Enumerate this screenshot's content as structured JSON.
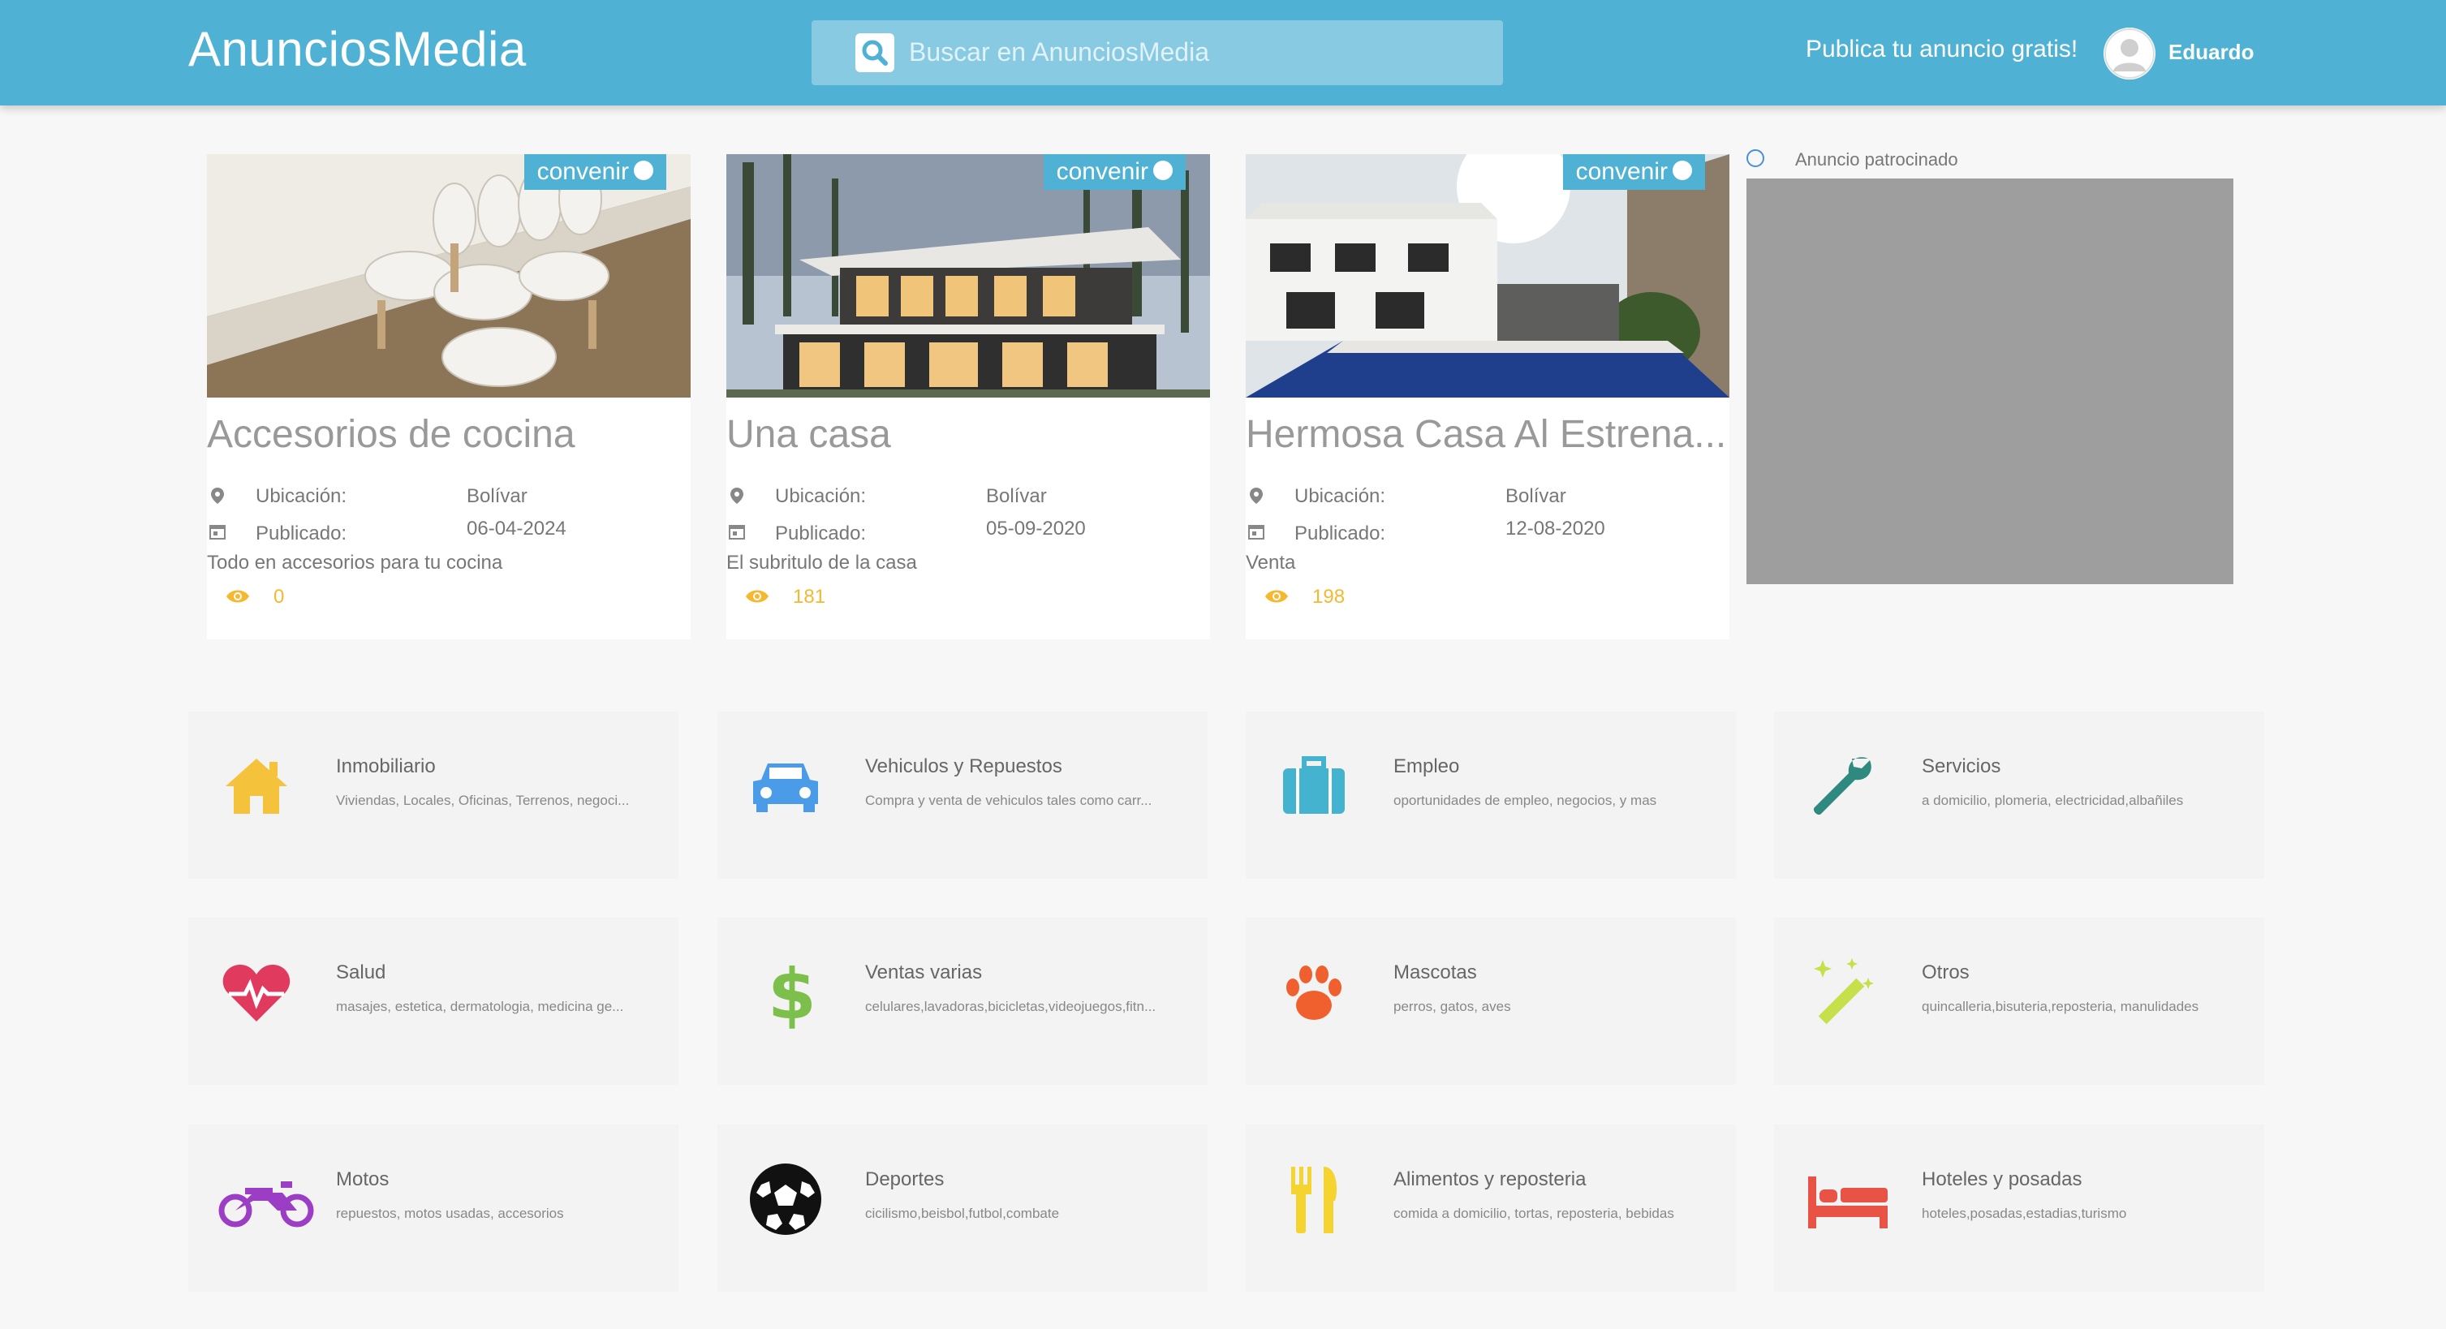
{
  "header": {
    "brand": "AnunciosMedia",
    "search_placeholder": "Buscar en AnunciosMedia",
    "publish_label": "Publica tu anuncio gratis!",
    "user_name": "Eduardo"
  },
  "listings": [
    {
      "badge": "convenir",
      "title": "Accesorios de cocina",
      "location_label": "Ubicación:",
      "location_value": "Bolívar",
      "published_label": "Publicado:",
      "published_value": "06-04-2024",
      "description": "Todo en accesorios para tu cocina",
      "views": "0"
    },
    {
      "badge": "convenir",
      "title": "Una casa",
      "location_label": "Ubicación:",
      "location_value": "Bolívar",
      "published_label": "Publicado:",
      "published_value": "05-09-2020",
      "description": "El subritulo de la casa",
      "views": "181"
    },
    {
      "badge": "convenir",
      "title": "Hermosa Casa Al Estrena...",
      "location_label": "Ubicación:",
      "location_value": "Bolívar",
      "published_label": "Publicado:",
      "published_value": "12-08-2020",
      "description": "Venta",
      "views": "198"
    }
  ],
  "ad": {
    "label": "Anuncio patrocinado"
  },
  "categories": [
    {
      "name": "Inmobiliario",
      "description": "Viviendas, Locales, Oficinas, Terrenos, negoci...",
      "icon": "house-icon",
      "color": "#f5c33b"
    },
    {
      "name": "Vehiculos y Repuestos",
      "description": "Compra y venta de vehiculos tales como carr...",
      "icon": "car-icon",
      "color": "#4a9be8"
    },
    {
      "name": "Empleo",
      "description": "oportunidades de empleo, negocios, y mas",
      "icon": "briefcase-icon",
      "color": "#44b3cf"
    },
    {
      "name": "Servicios",
      "description": "a domicilio, plomeria, electricidad,albañiles",
      "icon": "wrench-icon",
      "color": "#2e8a7e"
    },
    {
      "name": "Salud",
      "description": "masajes, estetica, dermatologia, medicina ge...",
      "icon": "heart-pulse-icon",
      "color": "#e03b5f"
    },
    {
      "name": "Ventas varias",
      "description": "celulares,lavadoras,bicicletas,videojuegos,fitn...",
      "icon": "dollar-icon",
      "color": "#7cc04b"
    },
    {
      "name": "Mascotas",
      "description": "perros, gatos, aves",
      "icon": "paw-icon",
      "color": "#f0602f"
    },
    {
      "name": "Otros",
      "description": "quincalleria,bisuteria,reposteria, manulidades",
      "icon": "magic-wand-icon",
      "color": "#c5e04a"
    },
    {
      "name": "Motos",
      "description": "repuestos, motos usadas, accesorios",
      "icon": "motorcycle-icon",
      "color": "#9b3dc5"
    },
    {
      "name": "Deportes",
      "description": "cicilismo,beisbol,futbol,combate",
      "icon": "soccer-ball-icon",
      "color": "#111111"
    },
    {
      "name": "Alimentos y reposteria",
      "description": "comida a domicilio, tortas, reposteria, bebidas",
      "icon": "fork-knife-icon",
      "color": "#f5d430"
    },
    {
      "name": "Hoteles y posadas",
      "description": "hoteles,posadas,estadias,turismo",
      "icon": "bed-icon",
      "color": "#e85345"
    }
  ]
}
